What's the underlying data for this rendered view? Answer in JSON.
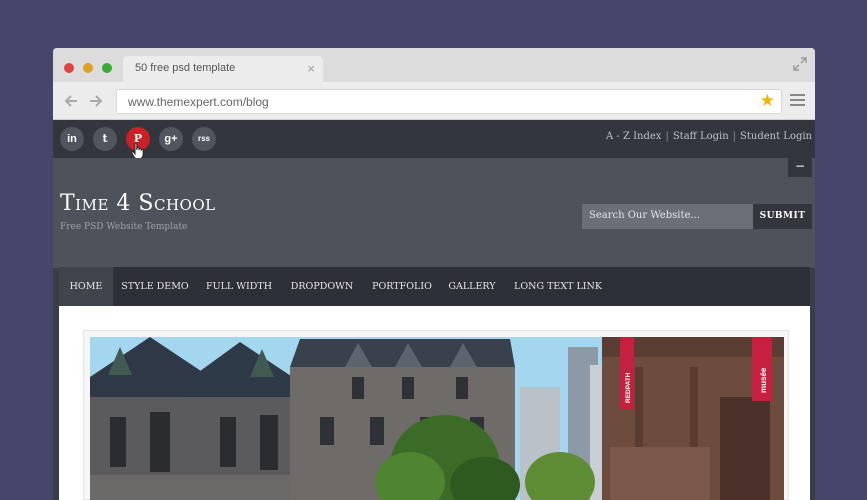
{
  "browser": {
    "tab_title": "50 free psd  template",
    "tab_close": "×",
    "url": "www.themexpert.com/blog"
  },
  "site": {
    "social_icons": [
      {
        "name": "linkedin-icon",
        "glyph": "in"
      },
      {
        "name": "twitter-icon",
        "glyph": "t"
      },
      {
        "name": "pinterest-icon",
        "glyph": "P"
      },
      {
        "name": "google-plus-icon",
        "glyph": "g+"
      },
      {
        "name": "rss-icon",
        "glyph": "rss"
      }
    ],
    "top_links": [
      "A - Z Index",
      "Staff Login",
      "Student Login"
    ],
    "separator": "|",
    "collapse_label": "−",
    "title": "Time 4 School",
    "tagline": "Free PSD Website Template",
    "search_placeholder": "Search Our Website...",
    "search_button": "SUBMIT",
    "nav": [
      "HOME",
      "STYLE DEMO",
      "FULL WIDTH",
      "DROPDOWN",
      "PORTFOLIO",
      "GALLERY",
      "LONG TEXT LINK"
    ],
    "banner_texts": [
      "musée",
      "REDPATH"
    ]
  },
  "colors": {
    "background": "#46456b",
    "pinterest_active": "#cb2027",
    "star": "#f0b800",
    "header": "#4e525b",
    "navbar": "#2d3036"
  }
}
